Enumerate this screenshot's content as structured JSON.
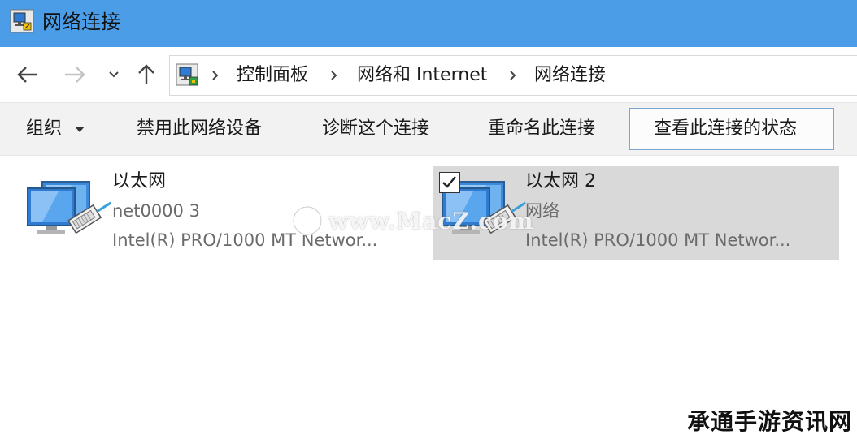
{
  "window": {
    "title": "网络连接",
    "icon": "network-connections-icon",
    "titlebar_color": "#4a9de6"
  },
  "navigation": {
    "back_icon": "arrow-left-icon",
    "forward_icon": "arrow-right-icon",
    "recent_icon": "chevron-down-icon",
    "up_icon": "arrow-up-icon"
  },
  "address": {
    "location_icon": "control-panel-icon",
    "breadcrumbs": [
      {
        "label": "控制面板"
      },
      {
        "label": "网络和 Internet"
      },
      {
        "label": "网络连接"
      }
    ]
  },
  "commandbar": {
    "organize": "组织",
    "disable": "禁用此网络设备",
    "diagnose": "诊断这个连接",
    "rename": "重命名此连接",
    "view_status": "查看此连接的状态"
  },
  "connections": [
    {
      "name": "以太网",
      "network": "net0000  3",
      "adapter": "Intel(R) PRO/1000 MT Networ...",
      "selected": false
    },
    {
      "name": "以太网 2",
      "network": "网络",
      "adapter": "Intel(R) PRO/1000 MT Networ...",
      "selected": true
    }
  ],
  "overlay": {
    "watermark": "www.MacZ.com",
    "corner_text": "承通手游资讯网"
  }
}
